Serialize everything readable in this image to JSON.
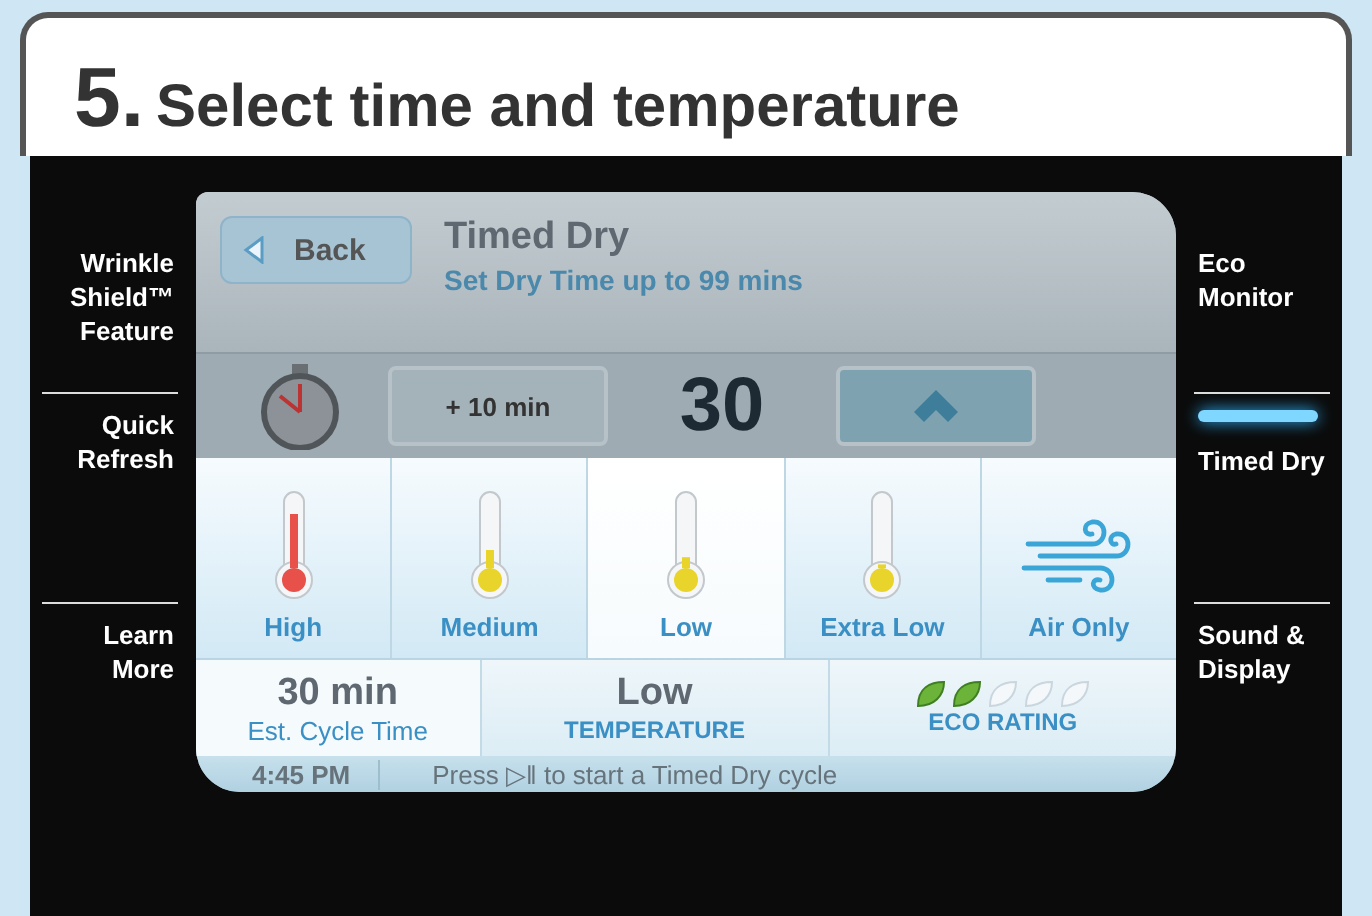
{
  "heading": {
    "number": "5.",
    "title": "Select time and temperature"
  },
  "left_menu": [
    {
      "label": "Wrinkle Shield™ Feature"
    },
    {
      "label": "Quick Refresh"
    },
    {
      "label": "Learn More"
    }
  ],
  "right_menu": [
    {
      "label": "Eco Monitor",
      "selected": false
    },
    {
      "label": "Timed Dry",
      "selected": true
    },
    {
      "label": "Sound & Display",
      "selected": false
    }
  ],
  "screen": {
    "back": "Back",
    "title": "Timed Dry",
    "subtitle": "Set Dry Time up to 99 mins",
    "add_time": "+ 10 min",
    "time": "30",
    "temperatures": [
      {
        "label": "High",
        "kind": "thermometer",
        "level": 0.75,
        "color": "#e8504a",
        "selected": false
      },
      {
        "label": "Medium",
        "kind": "thermometer",
        "level": 0.25,
        "color": "#e8d42a",
        "selected": false
      },
      {
        "label": "Low",
        "kind": "thermometer",
        "level": 0.15,
        "color": "#e8d42a",
        "selected": true
      },
      {
        "label": "Extra Low",
        "kind": "thermometer",
        "level": 0.05,
        "color": "#e8d42a",
        "selected": false
      },
      {
        "label": "Air Only",
        "kind": "air",
        "selected": false
      }
    ],
    "summary": {
      "cycle_time": "30 min",
      "cycle_time_label": "Est. Cycle Time",
      "temperature": "Low",
      "temperature_label": "TEMPERATURE",
      "eco_rating": {
        "stars": 2
      },
      "eco_label": "ECO RATING"
    },
    "status": {
      "time": "4:45 PM",
      "message": "Press ▷‖ to start a Timed Dry cycle"
    }
  }
}
